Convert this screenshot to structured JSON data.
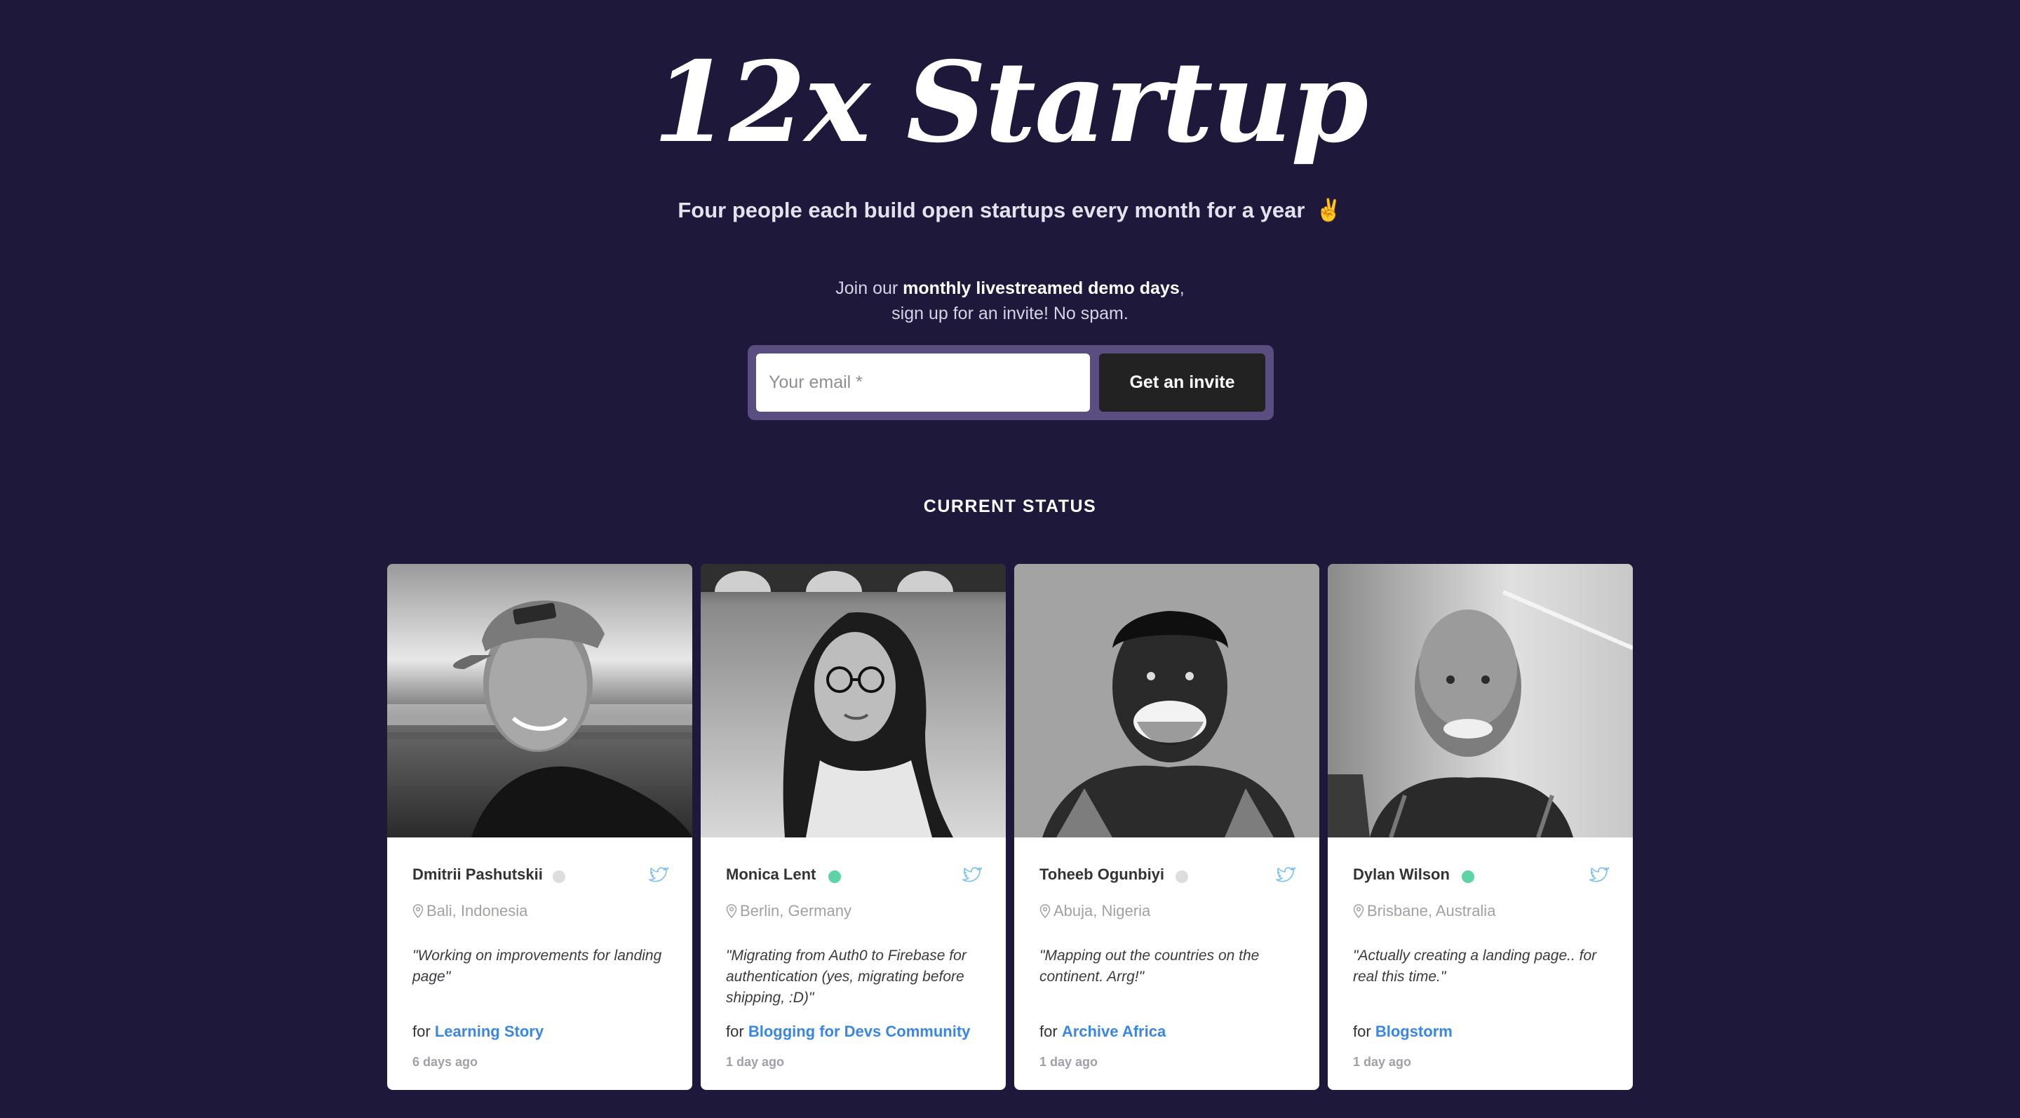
{
  "hero": {
    "title": "12x Startup",
    "subtitle": "Four people each build open startups every month for a year",
    "subtitle_emoji": "✌️"
  },
  "join": {
    "prefix": "Join our ",
    "highlight": "monthly livestreamed demo days",
    "suffix": ",",
    "line2": "sign up for an invite! No spam."
  },
  "signup": {
    "email_placeholder": "Your email *",
    "email_value": "",
    "button_label": "Get an invite"
  },
  "status_section": {
    "heading": "CURRENT STATUS"
  },
  "colors": {
    "background": "#1e183b",
    "form_frame": "#5a4e80",
    "button": "#222222",
    "link": "#3a86e0",
    "online": "#5ed3a3",
    "offline": "#dddddd",
    "twitter": "#7cc0ec"
  },
  "cards": [
    {
      "name": "Dmitrii Pashutskii",
      "status": "offline",
      "location": "Bali, Indonesia",
      "quote": "\"Working on improvements for landing page\"",
      "for_label": "for",
      "project": "Learning Story",
      "time": "6 days ago",
      "photo_icon": "portrait-photo-man-cap"
    },
    {
      "name": "Monica Lent",
      "status": "online",
      "location": "Berlin, Germany",
      "quote": "\"Migrating from Auth0 to Firebase for authentication (yes, migrating before shipping, :D)\"",
      "for_label": "for",
      "project": "Blogging for Devs Community",
      "time": "1 day ago",
      "photo_icon": "portrait-photo-woman-glasses"
    },
    {
      "name": "Toheeb Ogunbiyi",
      "status": "offline",
      "location": "Abuja, Nigeria",
      "quote": "\"Mapping out the countries on the continent. Arrg!\"",
      "for_label": "for",
      "project": "Archive Africa",
      "time": "1 day ago",
      "photo_icon": "portrait-photo-man-smiling"
    },
    {
      "name": "Dylan Wilson",
      "status": "online",
      "location": "Brisbane, Australia",
      "quote": "\"Actually creating a landing page.. for real this time.\"",
      "for_label": "for",
      "project": "Blogstorm",
      "time": "1 day ago",
      "photo_icon": "portrait-photo-man-bald"
    }
  ]
}
